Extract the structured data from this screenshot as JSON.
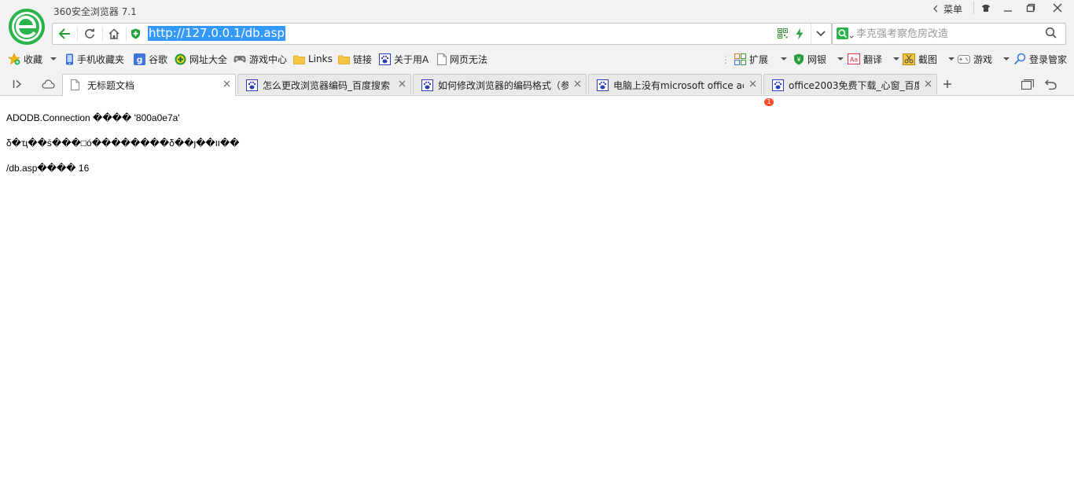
{
  "window": {
    "title": "360安全浏览器 7.1",
    "menu_label": "菜单"
  },
  "address_bar": {
    "url": "http://127.0.0.1/db.asp"
  },
  "search": {
    "placeholder": "李克强考察危房改造"
  },
  "bookmarks": [
    {
      "label": "收藏",
      "icon": "star-icon",
      "dropdown": true
    },
    {
      "label": "手机收藏夹",
      "icon": "phone-icon"
    },
    {
      "label": "谷歌",
      "icon": "google-icon"
    },
    {
      "label": "网址大全",
      "icon": "plus-circle-icon"
    },
    {
      "label": "游戏中心",
      "icon": "gamepad-icon"
    },
    {
      "label": "Links",
      "icon": "folder-icon"
    },
    {
      "label": "链接",
      "icon": "folder-icon"
    },
    {
      "label": "关于用A",
      "icon": "baidu-paw-icon"
    },
    {
      "label": "网页无法",
      "icon": "page-icon"
    }
  ],
  "toolbar_right": [
    {
      "label": "扩展",
      "icon": "extensions-icon",
      "badge": "1"
    },
    {
      "label": "网银",
      "icon": "shield-icon"
    },
    {
      "label": "翻译",
      "icon": "translate-icon"
    },
    {
      "label": "截图",
      "icon": "scissors-icon"
    },
    {
      "label": "游戏",
      "icon": "game-icon"
    },
    {
      "label": "登录管家",
      "icon": "magnifier-key-icon"
    }
  ],
  "tabs": [
    {
      "label": "无标题文档",
      "active": true
    },
    {
      "label": "怎么更改浏览器编码_百度搜索",
      "active": false
    },
    {
      "label": "如何修改浏览器的编码格式（参",
      "active": false
    },
    {
      "label": "电脑上没有microsoft office ac",
      "active": false
    },
    {
      "label": "office2003免费下载_心窗_百度",
      "active": false
    }
  ],
  "page_content": {
    "line1": "ADODB.Connection  ���� '800a0e7a'",
    "line2": "δ�ҵ��ṡ���□ó��������δ��ȷ��װ��",
    "line3": "/db.asp���� 16"
  }
}
